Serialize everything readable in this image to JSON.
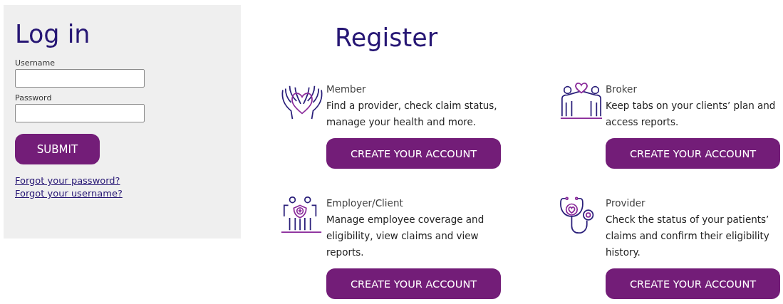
{
  "login": {
    "title": "Log in",
    "fields": [
      {
        "label": "Username"
      },
      {
        "label": "Password"
      }
    ],
    "submit": "SUBMIT",
    "links": [
      "Forgot your password?",
      "Forgot your username?"
    ]
  },
  "register": {
    "title": "Register",
    "cards": [
      {
        "kind": "member",
        "title": "Member",
        "description": "Find a provider, check claim status, manage your health and more.",
        "button": "CREATE YOUR ACCOUNT"
      },
      {
        "kind": "broker",
        "title": "Broker",
        "description": "Keep tabs on your clients’ plan and access reports.",
        "button": "CREATE YOUR ACCOUNT"
      },
      {
        "kind": "employer",
        "title": "Employer/Client",
        "description": "Manage employee coverage and eligibility, view claims and view reports.",
        "button": "CREATE YOUR ACCOUNT"
      },
      {
        "kind": "provider",
        "title": "Provider",
        "description": "Check the status of your patients’ claims and confirm their eligibility history.",
        "button": "CREATE YOUR ACCOUNT"
      }
    ]
  }
}
